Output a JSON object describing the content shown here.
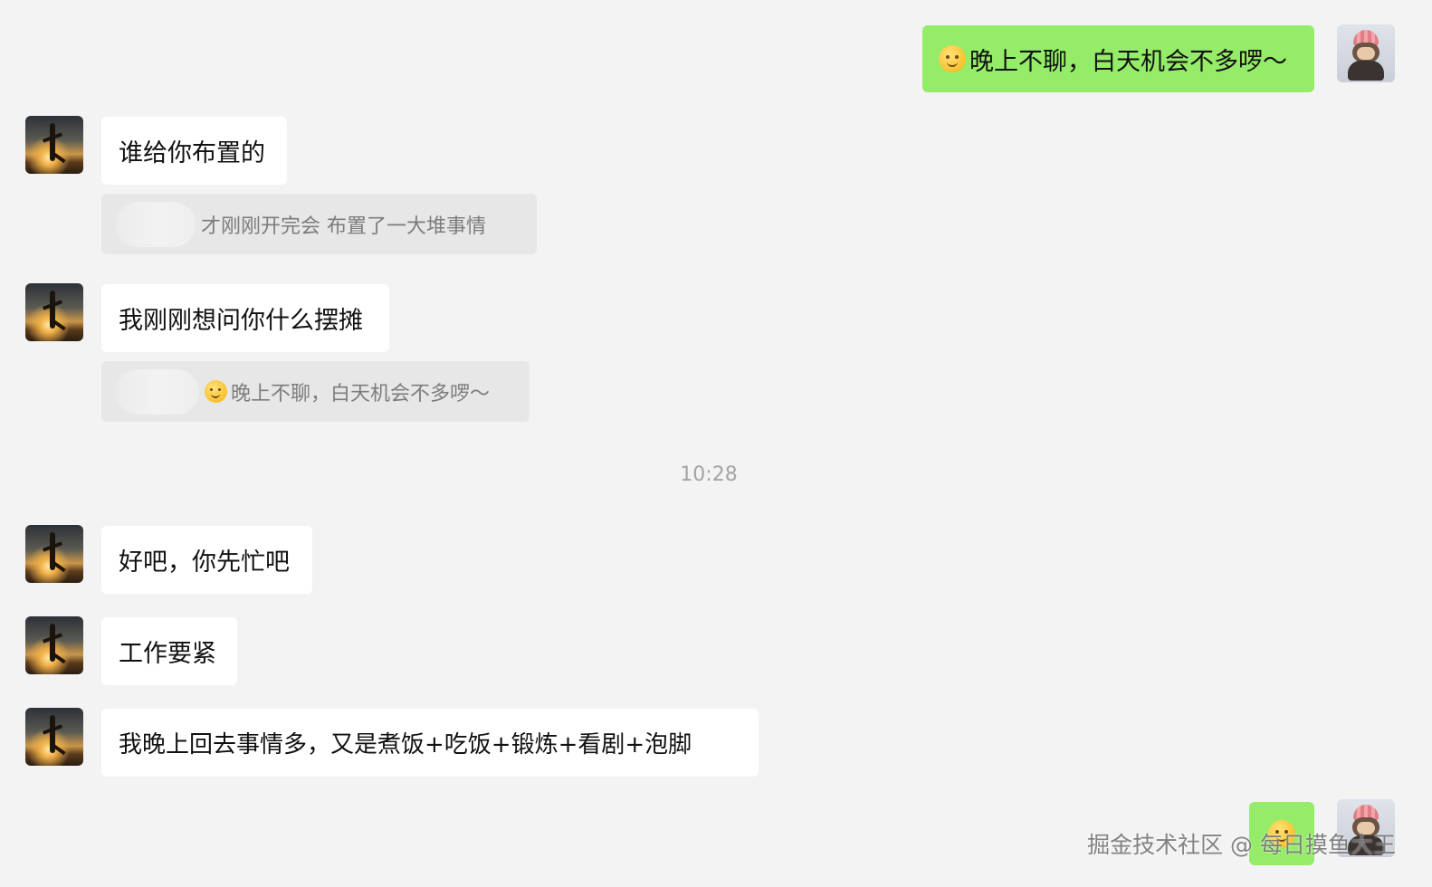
{
  "messages": {
    "m1": {
      "emoji": "smile-emoji",
      "text": "晚上不聊，白天机会不多啰～"
    },
    "m2": {
      "text": "谁给你布置的"
    },
    "q1": {
      "text": "才刚刚开完会 布置了一大堆事情"
    },
    "m3": {
      "text": "我刚刚想问你什么摆摊"
    },
    "q2": {
      "emoji": "smile-emoji",
      "text": "晚上不聊，白天机会不多啰～"
    },
    "timestamp": "10:28",
    "m4": {
      "text": "好吧，你先忙吧"
    },
    "m5": {
      "text": "工作要紧"
    },
    "m6": {
      "text": "我晚上回去事情多，又是煮饭+吃饭+锻炼+看剧+泡脚"
    },
    "m7": {
      "emoji": "smile-emoji"
    }
  },
  "watermark": "掘金技术社区 @ 每日摸鱼大王",
  "colors": {
    "background": "#f3f3f3",
    "sent_bubble": "#95ec69",
    "received_bubble": "#ffffff",
    "quote": "#e7e7e7"
  }
}
